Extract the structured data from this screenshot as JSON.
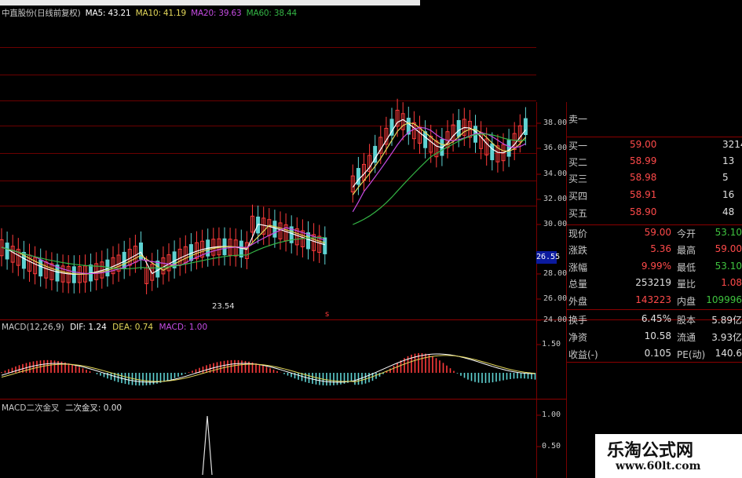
{
  "main_title": {
    "stock": "中直股份(日线前复权)",
    "ma5": "MA5: 43.21",
    "ma10": "MA10: 41.19",
    "ma20": "MA20: 39.63",
    "ma60": "MA60: 38.44"
  },
  "colors": {
    "up": "#ff3b3b",
    "down": "#5fd3d3",
    "ma5": "#ffffff",
    "ma10": "#e3d75a",
    "ma20": "#c64ce3",
    "ma60": "#34b545",
    "grid": "#6b0000",
    "axis": "#8b0000"
  },
  "price_axis": [
    "38.00",
    "36.00",
    "34.00",
    "32.00",
    "30.00",
    "28.00",
    "26.00",
    "24.00"
  ],
  "current_price_tag": "26.55",
  "low_annotation": "23.54",
  "markers": [
    "s"
  ],
  "macd": {
    "label": "MACD(12,26,9)",
    "dif": "DIF: 1.24",
    "dea": "DEA: 0.74",
    "macd": "MACD: 1.00",
    "axis": [
      "1.50"
    ]
  },
  "macd2": {
    "label": "MACD二次金叉",
    "value": "二次金叉: 0.00",
    "axis": [
      "1.00",
      "0.50"
    ]
  },
  "order_book": [
    {
      "label": "卖一",
      "price": "",
      "volume": ""
    },
    {
      "label": "买一",
      "price": "59.00",
      "volume": "3214"
    },
    {
      "label": "买二",
      "price": "58.99",
      "volume": "13"
    },
    {
      "label": "买三",
      "price": "58.98",
      "volume": "5"
    },
    {
      "label": "买四",
      "price": "58.91",
      "volume": "16"
    },
    {
      "label": "买五",
      "price": "58.90",
      "volume": "48"
    }
  ],
  "stats": [
    {
      "k1": "现价",
      "v1": "59.00",
      "k2": "今开",
      "v2": "53.10",
      "c1": "#ff4a4a",
      "c2": "#3fc43f"
    },
    {
      "k1": "涨跌",
      "v1": "5.36",
      "k2": "最高",
      "v2": "59.00",
      "c1": "#ff4a4a",
      "c2": "#ff4a4a"
    },
    {
      "k1": "涨幅",
      "v1": "9.99%",
      "k2": "最低",
      "v2": "53.10",
      "c1": "#ff4a4a",
      "c2": "#3fc43f"
    },
    {
      "k1": "总量",
      "v1": "253219",
      "k2": "量比",
      "v2": "1.08",
      "c1": "#e0e0e0",
      "c2": "#ff4a4a"
    },
    {
      "k1": "外盘",
      "v1": "143223",
      "k2": "内盘",
      "v2": "109996",
      "c1": "#ff4a4a",
      "c2": "#3fc43f"
    },
    {
      "k1": "换手",
      "v1": "6.45%",
      "k2": "股本",
      "v2": "5.89亿",
      "c1": "#e0e0e0",
      "c2": "#e0e0e0"
    },
    {
      "k1": "净资",
      "v1": "10.58",
      "k2": "流通",
      "v2": "3.93亿",
      "c1": "#e0e0e0",
      "c2": "#e0e0e0"
    },
    {
      "k1": "收益(-)",
      "v1": "0.105",
      "k2": "PE(动)",
      "v2": "140.6",
      "c1": "#e0e0e0",
      "c2": "#e0e0e0"
    }
  ],
  "watermark": {
    "cn": "乐淘公式网",
    "url": "www.60lt.com"
  }
}
